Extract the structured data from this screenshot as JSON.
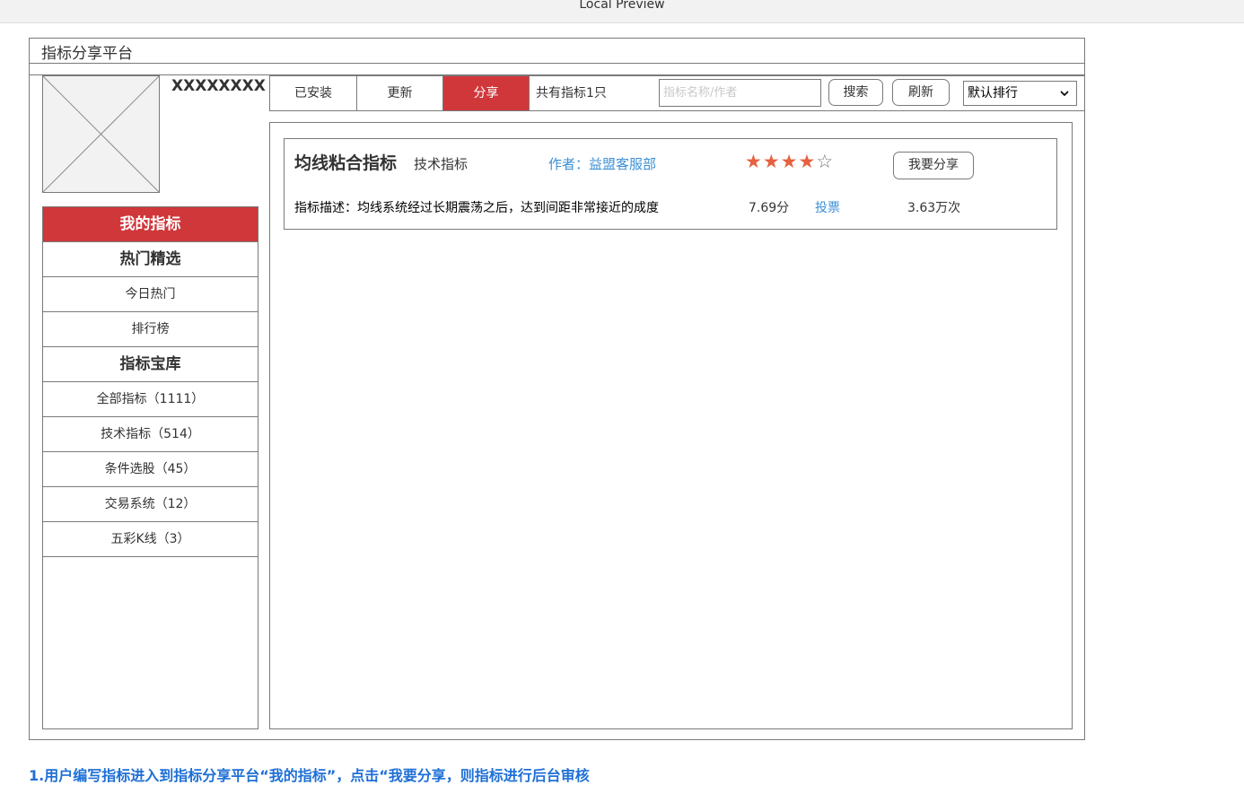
{
  "window": {
    "title": "Local Preview"
  },
  "app": {
    "title": "指标分享平台"
  },
  "profile": {
    "username": "XXXXXXXX"
  },
  "sidebar": {
    "items": [
      {
        "label": "我的指标"
      },
      {
        "label": "热门精选"
      },
      {
        "label": "今日热门"
      },
      {
        "label": "排行榜"
      },
      {
        "label": "指标宝库"
      },
      {
        "label": "全部指标（1111）"
      },
      {
        "label": "技术指标（514）"
      },
      {
        "label": "条件选股（45）"
      },
      {
        "label": "交易系统（12）"
      },
      {
        "label": "五彩K线（3）"
      }
    ]
  },
  "tabs": [
    {
      "label": "已安装"
    },
    {
      "label": "更新"
    },
    {
      "label": "分享"
    }
  ],
  "toolbar": {
    "count_text": "共有指标1只",
    "search_placeholder": "指标名称/作者",
    "search_label": "搜索",
    "refresh_label": "刷新",
    "sort_value": "默认排行",
    "accent_color": "#d0373a"
  },
  "card": {
    "title": "均线粘合指标",
    "category": "技术指标",
    "author": "作者：益盟客服部",
    "rating": 4,
    "rating_max": 5,
    "share_label": "我要分享",
    "description": "指标描述：均线系统经过长期震荡之后，达到间距非常接近的成度",
    "score": "7.69分",
    "vote_label": "投票",
    "views": "3.63万次"
  },
  "footer": {
    "note": "1.用户编写指标进入到指标分享平台“我的指标”，点击“我要分享，则指标进行后台审核"
  }
}
